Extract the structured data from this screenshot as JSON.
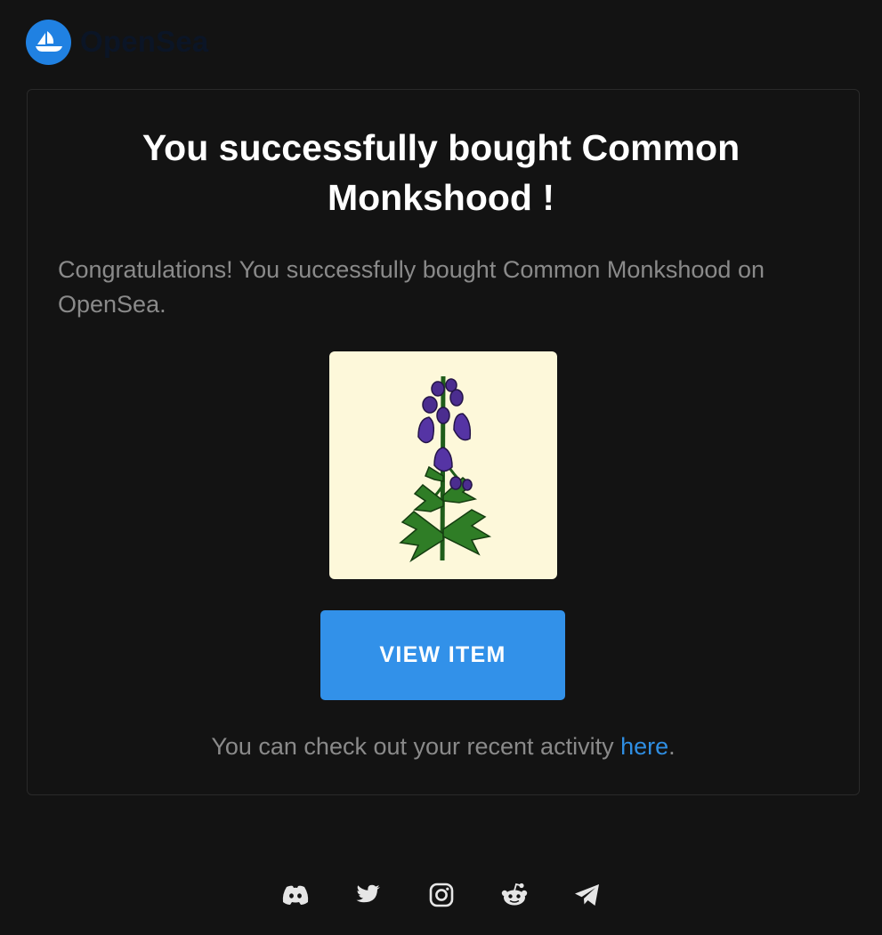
{
  "brand": {
    "name": "OpenSea",
    "logo_icon": "opensea-ship-icon",
    "accent": "#2081e2"
  },
  "content": {
    "title": "You successfully bought Common Monkshood !",
    "body": "Congratulations! You successfully bought Common Monkshood on OpenSea.",
    "item_image_alt": "common-monkshood-flower-illustration",
    "view_button_label": "VIEW ITEM",
    "activity_text_before": "You can check out your recent activity ",
    "activity_link_label": "here",
    "activity_text_after": "."
  },
  "footer": {
    "socials": [
      {
        "name": "discord",
        "icon": "discord-icon"
      },
      {
        "name": "twitter",
        "icon": "twitter-icon"
      },
      {
        "name": "instagram",
        "icon": "instagram-icon"
      },
      {
        "name": "reddit",
        "icon": "reddit-icon"
      },
      {
        "name": "telegram",
        "icon": "telegram-icon"
      }
    ]
  },
  "colors": {
    "background": "#131313",
    "card_border": "#2a2a2a",
    "button": "#3291e9",
    "link": "#2f8ee2",
    "muted_text": "#8a8a8a",
    "image_bg": "#fdf8da"
  }
}
